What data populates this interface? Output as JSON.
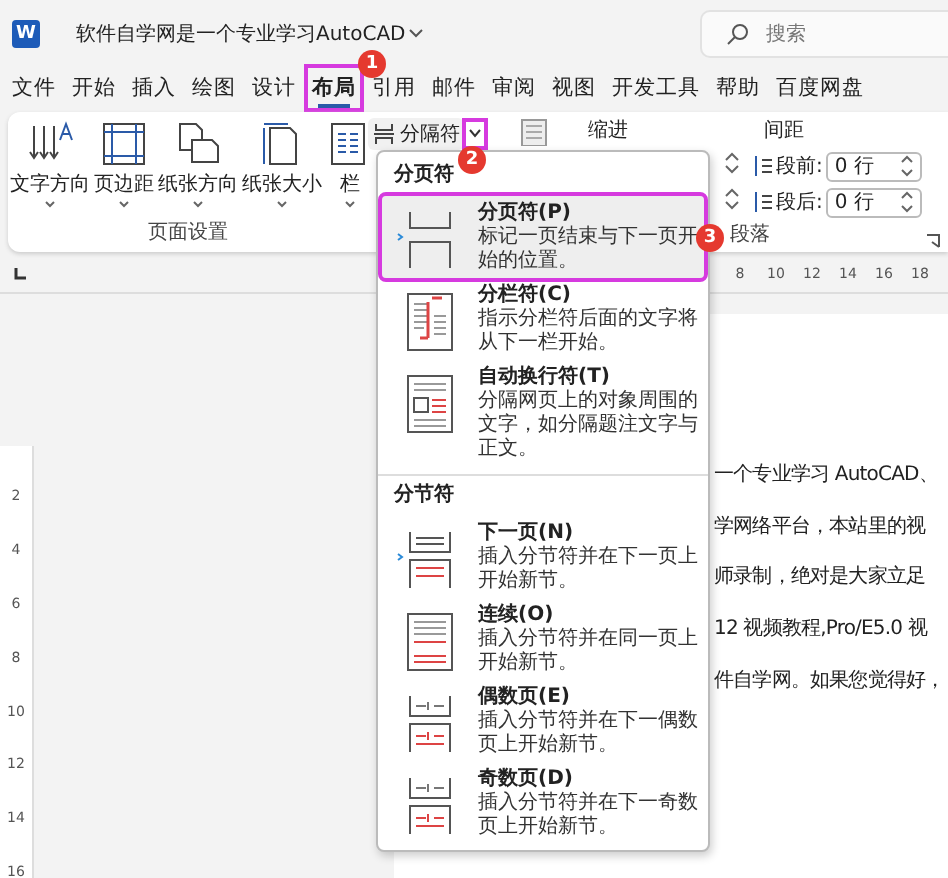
{
  "title_bar": {
    "app_logo": "W",
    "document_title": "软件自学网是一个专业学习AutoCAD",
    "search": {
      "placeholder": "搜索"
    }
  },
  "menu_tabs": [
    {
      "label": "文件",
      "selected": false
    },
    {
      "label": "开始",
      "selected": false
    },
    {
      "label": "插入",
      "selected": false
    },
    {
      "label": "绘图",
      "selected": false
    },
    {
      "label": "设计",
      "selected": false
    },
    {
      "label": "布局",
      "selected": true,
      "callout": "1"
    },
    {
      "label": "引用",
      "selected": false
    },
    {
      "label": "邮件",
      "selected": false
    },
    {
      "label": "审阅",
      "selected": false
    },
    {
      "label": "视图",
      "selected": false
    },
    {
      "label": "开发工具",
      "selected": false
    },
    {
      "label": "帮助",
      "selected": false
    },
    {
      "label": "百度网盘",
      "selected": false
    }
  ],
  "ribbon": {
    "page_setup": {
      "buttons": [
        {
          "kind": "text-direction",
          "label": "文字方向"
        },
        {
          "kind": "margins",
          "label": "页边距"
        },
        {
          "kind": "orientation",
          "label": "纸张方向"
        },
        {
          "kind": "size",
          "label": "纸张大小"
        },
        {
          "kind": "columns",
          "label": "栏"
        }
      ],
      "group_label": "页面设置"
    },
    "breaks_button": {
      "label": "分隔符",
      "expanded": true,
      "callout": "2"
    },
    "paragraph": {
      "indent_label": "缩进",
      "spacing_label": "间距",
      "spacing_fields": [
        {
          "label": "段前:",
          "value": "0 行"
        },
        {
          "label": "段后:",
          "value": "0 行"
        }
      ],
      "group_label": "段落"
    }
  },
  "ruler": {
    "top_numbers": [
      "8",
      "10",
      "12",
      "14",
      "16",
      "18"
    ],
    "side_numbers": [
      "2",
      "4",
      "6",
      "8",
      "10",
      "12",
      "14",
      "16"
    ]
  },
  "document": {
    "lines": [
      "一个专业学习 AutoCAD、",
      "学网络平台，本站里的视",
      "师录制，绝对是大家立足",
      "12 视频教程,Pro/E5.0 视",
      "件自学网。如果您觉得好，"
    ]
  },
  "breaks_menu": {
    "sections": [
      {
        "heading": "分页符",
        "items": [
          {
            "kind": "page",
            "title": "分页符(P)",
            "description": "标记一页结束与下一页开始的位置。",
            "selected": true,
            "callout": "3"
          },
          {
            "kind": "column",
            "title": "分栏符(C)",
            "description": "指示分栏符后面的文字将从下一栏开始。",
            "selected": false
          },
          {
            "kind": "wrap",
            "title": "自动换行符(T)",
            "description": "分隔网页上的对象周围的文字，如分隔题注文字与正文。",
            "selected": false
          }
        ]
      },
      {
        "heading": "分节符",
        "items": [
          {
            "kind": "next",
            "title": "下一页(N)",
            "description": "插入分节符并在下一页上开始新节。",
            "selected": false
          },
          {
            "kind": "continuous",
            "title": "连续(O)",
            "description": "插入分节符并在同一页上开始新节。",
            "selected": false
          },
          {
            "kind": "even",
            "title": "偶数页(E)",
            "description": "插入分节符并在下一偶数页上开始新节。",
            "selected": false
          },
          {
            "kind": "odd",
            "title": "奇数页(D)",
            "description": "插入分节符并在下一奇数页上开始新节。",
            "selected": false
          }
        ]
      }
    ]
  }
}
